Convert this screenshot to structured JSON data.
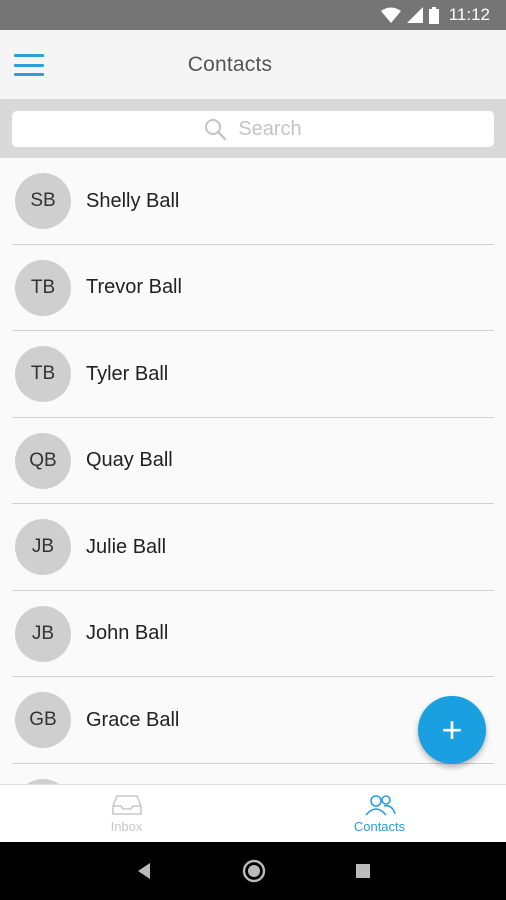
{
  "status_bar": {
    "time": "11:12"
  },
  "app_bar": {
    "title": "Contacts",
    "menu_icon": "hamburger-menu-icon"
  },
  "search": {
    "placeholder": "Search",
    "icon": "search-icon"
  },
  "contacts": [
    {
      "initials": "SB",
      "name": "Shelly Ball"
    },
    {
      "initials": "TB",
      "name": "Trevor Ball"
    },
    {
      "initials": "TB",
      "name": "Tyler Ball"
    },
    {
      "initials": "QB",
      "name": "Quay Ball"
    },
    {
      "initials": "JB",
      "name": "Julie Ball"
    },
    {
      "initials": "JB",
      "name": "John Ball"
    },
    {
      "initials": "GB",
      "name": "Grace Ball"
    }
  ],
  "fab": {
    "label": "+",
    "icon": "plus-icon"
  },
  "bottom_nav": [
    {
      "label": "Inbox",
      "icon": "inbox-tray-icon",
      "active": false
    },
    {
      "label": "Contacts",
      "icon": "people-icon",
      "active": true
    }
  ],
  "colors": {
    "accent": "#1a9fe0",
    "status_bar": "#757575",
    "avatar": "#cfcfcf"
  }
}
